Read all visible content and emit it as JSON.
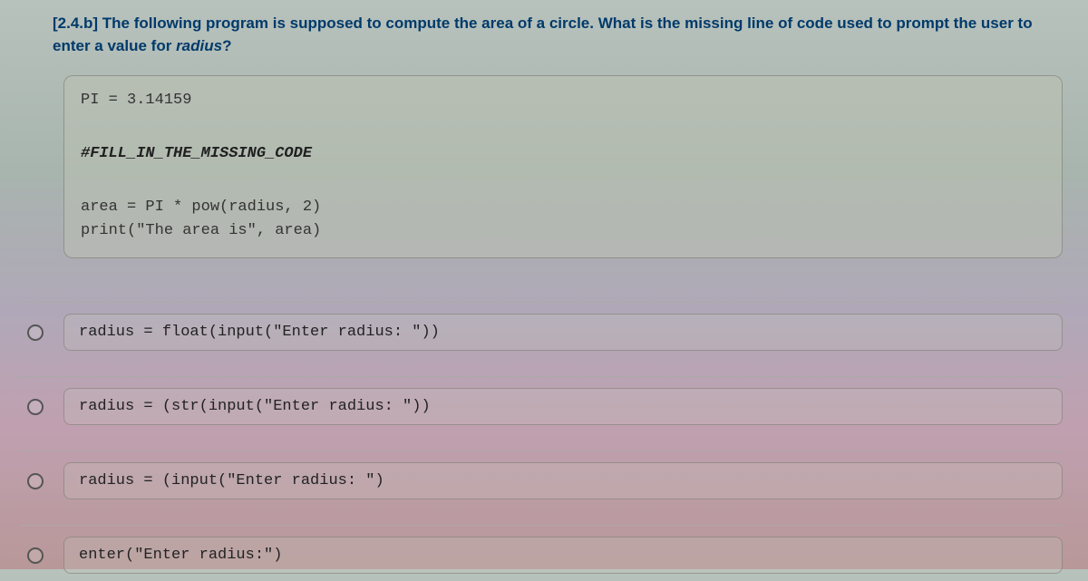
{
  "question": {
    "prefix": "[2.4.b] The following program is supposed to compute the area of a circle. What is the missing line of code used to prompt the user to enter a value for ",
    "italic": "radius",
    "suffix": "?"
  },
  "code": {
    "line1": "PI = 3.14159",
    "comment": "#FILL_IN_THE_MISSING_CODE",
    "line3": "area = PI * pow(radius, 2)",
    "line4": "print(\"The area is\", area)"
  },
  "options": [
    {
      "text": "radius = float(input(\"Enter radius: \"))"
    },
    {
      "text": "radius = (str(input(\"Enter radius: \"))"
    },
    {
      "text": "radius = (input(\"Enter radius: \")"
    },
    {
      "text": "enter(\"Enter radius:\")"
    }
  ]
}
